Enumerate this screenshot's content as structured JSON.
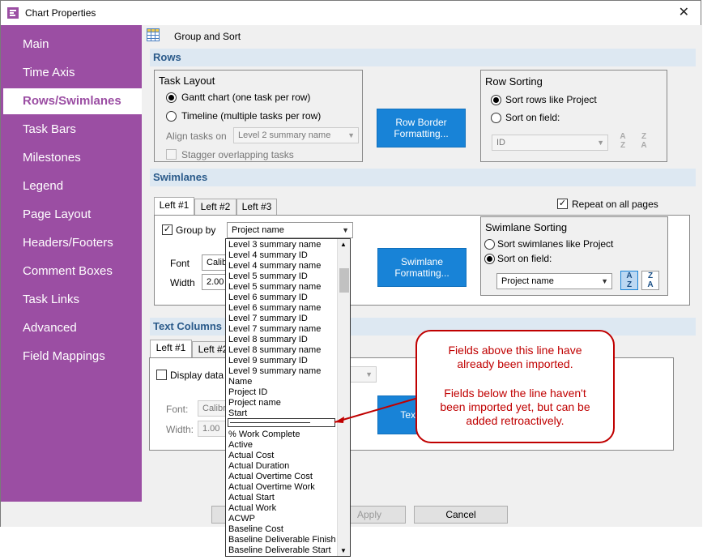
{
  "window": {
    "title": "Chart Properties",
    "close_glyph": "✕"
  },
  "sidebar": {
    "items": [
      {
        "label": "Main"
      },
      {
        "label": "Time Axis"
      },
      {
        "label": "Rows/Swimlanes"
      },
      {
        "label": "Task Bars"
      },
      {
        "label": "Milestones"
      },
      {
        "label": "Legend"
      },
      {
        "label": "Page Layout"
      },
      {
        "label": "Headers/Footers"
      },
      {
        "label": "Comment Boxes"
      },
      {
        "label": "Task Links"
      },
      {
        "label": "Advanced"
      },
      {
        "label": "Field Mappings"
      }
    ],
    "active_index": 2
  },
  "header": {
    "label": "Group and Sort"
  },
  "rows": {
    "section_title": "Rows",
    "task_layout": {
      "title": "Task Layout",
      "gantt_label": "Gantt chart (one task per row)",
      "timeline_label": "Timeline (multiple tasks per row)",
      "align_label": "Align tasks on",
      "align_value": "Level 2 summary name",
      "stagger_label": "Stagger overlapping tasks"
    },
    "row_border_button": "Row Border Formatting...",
    "row_sorting": {
      "title": "Row Sorting",
      "like_project_label": "Sort rows like Project",
      "on_field_label": "Sort on field:",
      "field_value": "ID"
    }
  },
  "swimlanes": {
    "section_title": "Swimlanes",
    "tabs": [
      "Left #1",
      "Left #2",
      "Left #3"
    ],
    "repeat_label": "Repeat on all pages",
    "group_by_label": "Group by",
    "group_by_value": "Project name",
    "font_label": "Font",
    "font_value": "Calibri",
    "width_label": "Width",
    "width_value": "2.00",
    "formatting_button": "Swimlane Formatting...",
    "sorting": {
      "title": "Swimlane Sorting",
      "like_project_label": "Sort swimlanes like Project",
      "on_field_label": "Sort on field:",
      "field_value": "Project name"
    }
  },
  "text_columns": {
    "section_title": "Text Columns",
    "tabs": [
      "Left #1",
      "Left #2"
    ],
    "display_label": "Display data",
    "font_label": "Font:",
    "font_value": "Calibri",
    "width_label": "Width:",
    "width_value": "1.00",
    "button_partial": "Text Form"
  },
  "dropdown": {
    "items": [
      "Level 3 summary name",
      "Level 4 summary ID",
      "Level 4 summary name",
      "Level 5 summary ID",
      "Level 5 summary name",
      "Level 6 summary ID",
      "Level 6 summary name",
      "Level 7 summary ID",
      "Level 7 summary name",
      "Level 8 summary ID",
      "Level 8 summary name",
      "Level 9 summary ID",
      "Level 9 summary name",
      "Name",
      "Project ID",
      "Project name",
      "Start",
      "",
      "% Work Complete",
      "Active",
      "Actual Cost",
      "Actual Duration",
      "Actual Overtime Cost",
      "Actual Overtime Work",
      "Actual Start",
      "Actual Work",
      "ACWP",
      "Baseline Cost",
      "Baseline Deliverable Finish",
      "Baseline Deliverable Start"
    ]
  },
  "callout": {
    "line1": "Fields above this line have",
    "line2": "already been imported.",
    "line3": "Fields below the line haven't",
    "line4": "been imported yet, but can be",
    "line5": "added retroactively."
  },
  "footer": {
    "apply_label": "Apply",
    "cancel_label": "Cancel"
  },
  "colors": {
    "sidebar": "#9b4ea3",
    "accent_blue": "#1883d7",
    "callout_red": "#c00000"
  }
}
